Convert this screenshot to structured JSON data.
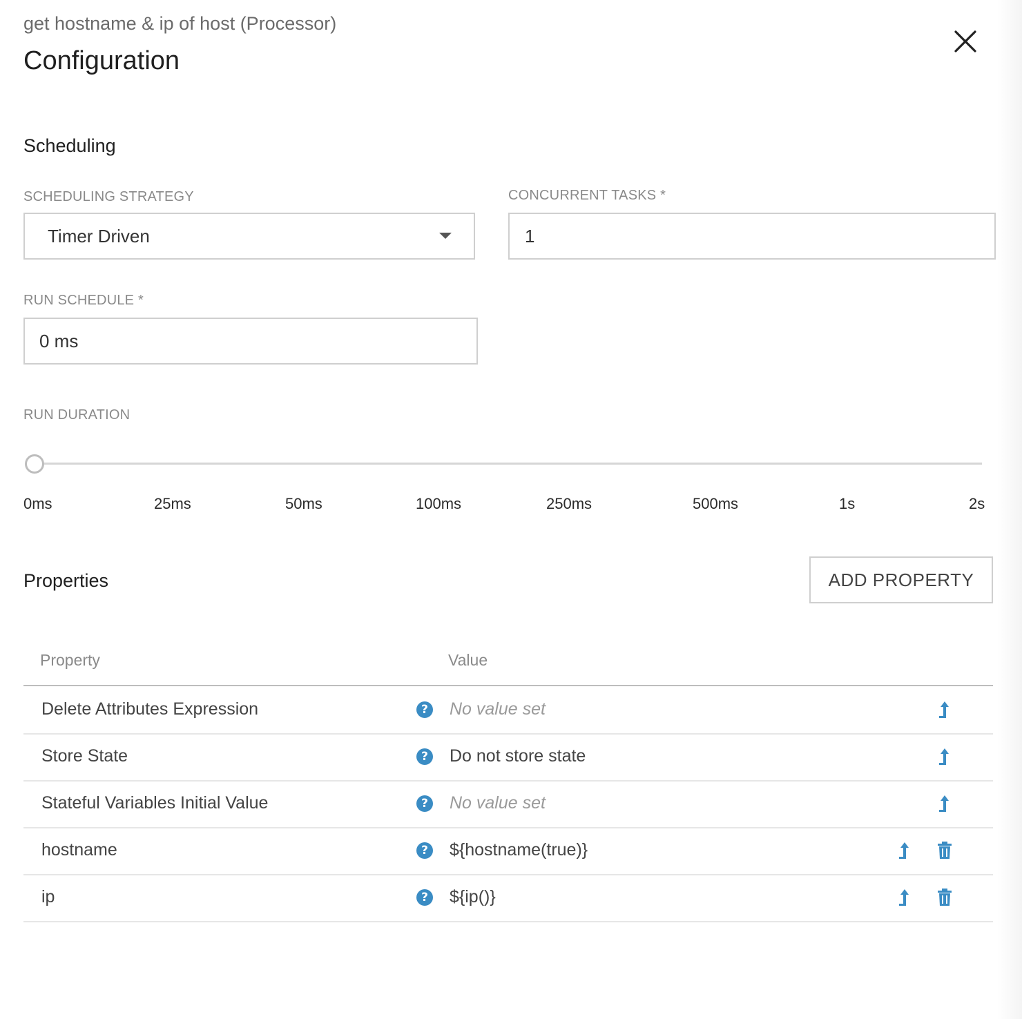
{
  "header": {
    "subtitle": "get hostname & ip of host (Processor)",
    "title": "Configuration",
    "close_icon": "close-icon"
  },
  "scheduling": {
    "heading": "Scheduling",
    "strategy": {
      "label": "SCHEDULING STRATEGY",
      "value": "Timer Driven"
    },
    "concurrent_tasks": {
      "label": "CONCURRENT TASKS *",
      "value": "1"
    },
    "run_schedule": {
      "label": "RUN SCHEDULE *",
      "value": "0 ms"
    },
    "run_duration": {
      "label": "RUN DURATION",
      "selected_index": 0,
      "ticks": [
        "0ms",
        "25ms",
        "50ms",
        "100ms",
        "250ms",
        "500ms",
        "1s",
        "2s"
      ]
    }
  },
  "properties": {
    "heading": "Properties",
    "add_button": "ADD PROPERTY",
    "columns": {
      "property": "Property",
      "value": "Value"
    },
    "rows": [
      {
        "name": "Delete Attributes Expression",
        "value": "No value set",
        "empty": true,
        "deletable": false
      },
      {
        "name": "Store State",
        "value": "Do not store state",
        "empty": false,
        "deletable": false
      },
      {
        "name": "Stateful Variables Initial Value",
        "value": "No value set",
        "empty": true,
        "deletable": false
      },
      {
        "name": "hostname",
        "value": "${hostname(true)}",
        "empty": false,
        "deletable": true
      },
      {
        "name": "ip",
        "value": "${ip()}",
        "empty": false,
        "deletable": true
      }
    ]
  },
  "colors": {
    "accent": "#3a8cc4"
  }
}
